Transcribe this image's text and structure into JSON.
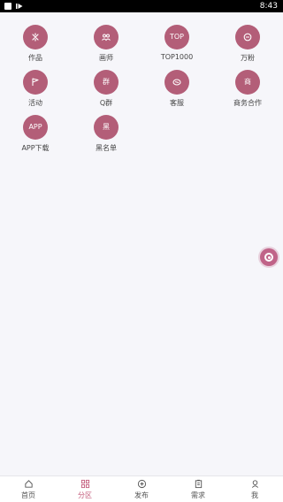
{
  "status_bar": {
    "time": "8:43"
  },
  "categories": [
    {
      "label": "作品",
      "icon": "sparkle-icon",
      "glyph": ""
    },
    {
      "label": "画师",
      "icon": "people-icon",
      "glyph": ""
    },
    {
      "label": "TOP1000",
      "icon": "top-icon",
      "glyph": "TOP"
    },
    {
      "label": "万粉",
      "icon": "chat-bubble-icon",
      "glyph": ""
    },
    {
      "label": "活动",
      "icon": "flag-icon",
      "glyph": ""
    },
    {
      "label": "Q群",
      "icon": "group-icon",
      "glyph": "群"
    },
    {
      "label": "客服",
      "icon": "service-icon",
      "glyph": ""
    },
    {
      "label": "商务合作",
      "icon": "business-icon",
      "glyph": "商"
    },
    {
      "label": "APP下载",
      "icon": "app-icon",
      "glyph": "APP"
    },
    {
      "label": "黑名单",
      "icon": "blacklist-icon",
      "glyph": "黑"
    }
  ],
  "tabbar": {
    "items": [
      {
        "label": "首页",
        "icon": "home-icon"
      },
      {
        "label": "分区",
        "icon": "grid-icon"
      },
      {
        "label": "发布",
        "icon": "plus-circle-icon"
      },
      {
        "label": "需求",
        "icon": "clipboard-icon"
      },
      {
        "label": "我",
        "icon": "user-icon"
      }
    ],
    "active_index": 1
  },
  "colors": {
    "accent": "#b35e78",
    "tab_active": "#c45d7d",
    "background": "#f6f6fa"
  }
}
